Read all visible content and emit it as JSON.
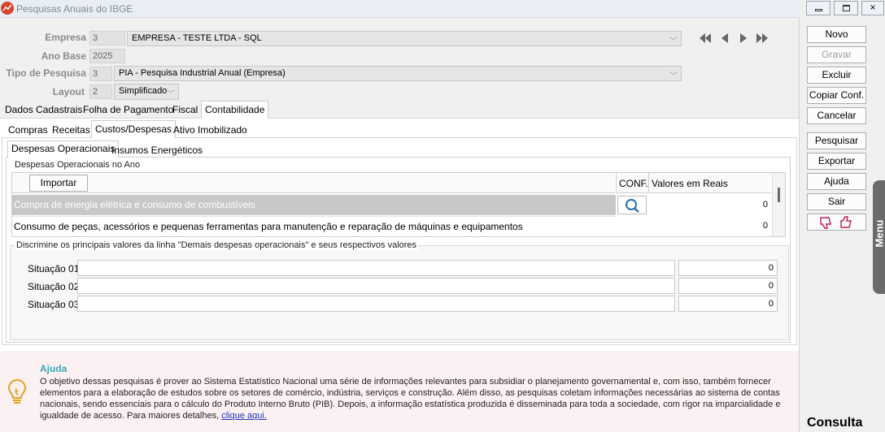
{
  "window": {
    "title": "Pesquisas Anuais do IBGE",
    "controls": [
      "minimize",
      "restore",
      "close"
    ]
  },
  "form": {
    "empresa_label": "Empresa",
    "empresa_code": "3",
    "empresa_value": "EMPRESA - TESTE LTDA - SQL",
    "ano_base_label": "Ano Base",
    "ano_base_value": "2025",
    "tipo_label": "Tipo de Pesquisa",
    "tipo_code": "3",
    "tipo_value": "PIA - Pesquisa Industrial Anual (Empresa)",
    "layout_label": "Layout",
    "layout_code": "2",
    "layout_value": "Simplificado"
  },
  "tabs_main": [
    "Dados Cadastrais",
    "Folha de Pagamento",
    "Fiscal",
    "Contabilidade"
  ],
  "tabs_sub": [
    "Compras",
    "Receitas",
    "Custos/Despesas",
    "Ativo Imobilizado"
  ],
  "tabs_inner": [
    "Despesas Operacionais",
    "Insumos Energéticos"
  ],
  "despesas": {
    "group_title": "Despesas Operacionais no Ano",
    "import_label": "Importar",
    "col_conf": "CONF.",
    "col_valores": "Valores em Reais",
    "rows": [
      {
        "label": "Compra de energia elétrica e consumo de combustíveis",
        "value": "0"
      },
      {
        "label": "Consumo de peças, acessórios e pequenas ferramentas para manutenção e reparação de máquinas e equipamentos",
        "value": "0"
      }
    ]
  },
  "demais": {
    "group_title": "Discrimine os principais valores da linha \"Demais despesas operacionais\" e seus respectivos valores",
    "rows": [
      {
        "label": "Situação 01",
        "value": "0"
      },
      {
        "label": "Situação 02",
        "value": "0"
      },
      {
        "label": "Situação 03",
        "value": "0"
      }
    ]
  },
  "help": {
    "title": "Ajuda",
    "text": "O objetivo dessas pesquisas é prover ao Sistema Estatístico Nacional uma série de informações relevantes para subsidiar o planejamento governamental e, com isso, também fornecer elementos para a elaboração de estudos sobre os setores de comércio, indústria, serviços e construção. Além disso, as pesquisas coletam informações necessárias ao sistema de contas nacionais, sendo essenciais para o cálculo do Produto Interno Bruto (PIB). Depois, a informação estatística produzida é disseminada para toda a sociedade, com rigor na imparcialidade e igualdade de acesso. Para maiores detalhes,",
    "link": "clique aqui."
  },
  "buttons": {
    "novo": "Novo",
    "gravar": "Gravar",
    "excluir": "Excluir",
    "copiar": "Copiar Conf.",
    "cancelar": "Cancelar",
    "pesquisar": "Pesquisar",
    "exportar": "Exportar",
    "ajuda": "Ajuda",
    "sair": "Sair"
  },
  "side_menu_label": "Menu",
  "mode_label": "Consulta",
  "colors": {
    "accent_red": "#d8442c",
    "help_bg": "#fcf1f2",
    "help_title": "#3ea8b3",
    "selected_row": "#c8c8c8"
  }
}
